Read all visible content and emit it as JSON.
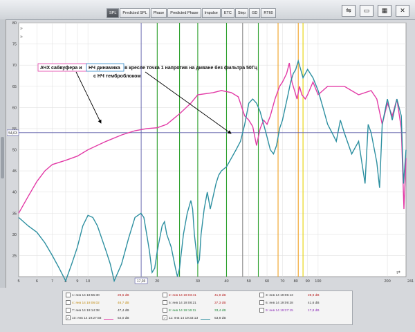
{
  "tabs": [
    "SPL",
    "Predicted SPL",
    "Phase",
    "Predicted Phase",
    "Impulse",
    "ETC",
    "Step",
    "GD",
    "RT60"
  ],
  "active_tab": "SPL",
  "toolbar_icons": [
    "chart-type-icon",
    "display-icon",
    "split-view-icon",
    "settings-icon"
  ],
  "toolbar_glyphs": [
    "⇋",
    "▭",
    "▦",
    "✕"
  ],
  "chart_data": {
    "type": "line",
    "x_scale": "log",
    "xlim": [
      5,
      241
    ],
    "ylim": [
      20,
      80
    ],
    "x_ticks": [
      5,
      6,
      7,
      8,
      9,
      10,
      20,
      30,
      40,
      50,
      60,
      70,
      80,
      90,
      100,
      200
    ],
    "x_end_label": "241 Hz",
    "cursor_x_label": "17,03",
    "y_ticks": [
      25,
      30,
      35,
      40,
      45,
      50,
      55,
      60,
      65,
      70,
      75,
      80
    ],
    "cursor_y_label": "54,03",
    "cursor_x": 17.03,
    "cursor_y": 54.03,
    "green_markers": [
      20,
      25,
      30,
      40,
      55
    ],
    "gray_markers": [
      47
    ],
    "orange_markers": [
      67,
      82
    ],
    "yellow_markers": [
      86
    ],
    "series": [
      {
        "color": "#e23aa6",
        "points": [
          [
            5,
            35
          ],
          [
            5.5,
            39
          ],
          [
            6,
            42.5
          ],
          [
            6.5,
            45
          ],
          [
            7,
            46.5
          ],
          [
            8,
            47.5
          ],
          [
            9,
            48.5
          ],
          [
            10,
            50
          ],
          [
            12,
            52
          ],
          [
            14,
            53.5
          ],
          [
            16,
            54.5
          ],
          [
            18,
            55
          ],
          [
            20,
            55.2
          ],
          [
            22,
            56
          ],
          [
            25,
            58.5
          ],
          [
            28,
            61
          ],
          [
            30,
            63
          ],
          [
            35,
            63.5
          ],
          [
            38,
            64
          ],
          [
            42,
            63.5
          ],
          [
            45,
            62.5
          ],
          [
            48,
            58
          ],
          [
            50,
            57
          ],
          [
            52,
            55.5
          ],
          [
            54,
            51
          ],
          [
            56,
            55
          ],
          [
            58,
            57
          ],
          [
            60,
            56
          ],
          [
            62,
            58
          ],
          [
            65,
            62
          ],
          [
            68,
            65
          ],
          [
            70,
            66
          ],
          [
            73,
            68
          ],
          [
            75,
            70.5
          ],
          [
            77,
            66
          ],
          [
            79,
            64
          ],
          [
            81,
            62
          ],
          [
            83,
            65
          ],
          [
            85,
            63
          ],
          [
            88,
            62
          ],
          [
            90,
            63
          ],
          [
            95,
            66
          ],
          [
            100,
            63
          ],
          [
            110,
            65
          ],
          [
            130,
            65
          ],
          [
            150,
            63
          ],
          [
            170,
            64
          ],
          [
            180,
            62
          ],
          [
            190,
            56
          ],
          [
            200,
            61
          ],
          [
            210,
            58
          ],
          [
            220,
            62
          ],
          [
            230,
            55
          ],
          [
            236,
            36
          ],
          [
            241,
            48
          ]
        ]
      },
      {
        "color": "#2c8fa0",
        "points": [
          [
            5,
            34
          ],
          [
            5.5,
            32
          ],
          [
            6,
            30.5
          ],
          [
            6.5,
            28
          ],
          [
            7,
            25
          ],
          [
            7.5,
            22
          ],
          [
            8,
            19
          ],
          [
            8.5,
            23
          ],
          [
            9,
            27
          ],
          [
            9.5,
            32
          ],
          [
            10,
            34.5
          ],
          [
            10.5,
            34
          ],
          [
            11,
            32
          ],
          [
            12,
            26
          ],
          [
            12.5,
            23
          ],
          [
            13,
            19
          ],
          [
            14,
            23
          ],
          [
            15,
            29
          ],
          [
            16,
            34
          ],
          [
            17,
            35
          ],
          [
            17.5,
            34
          ],
          [
            18,
            30
          ],
          [
            18.5,
            26
          ],
          [
            19,
            21
          ],
          [
            19.5,
            22
          ],
          [
            20,
            26
          ],
          [
            21,
            32
          ],
          [
            21.5,
            33
          ],
          [
            22,
            30
          ],
          [
            23,
            27
          ],
          [
            24,
            22
          ],
          [
            24.5,
            20
          ],
          [
            25,
            22
          ],
          [
            26,
            30
          ],
          [
            27,
            35
          ],
          [
            28,
            38
          ],
          [
            28.5,
            36
          ],
          [
            29,
            30
          ],
          [
            30,
            23
          ],
          [
            30.5,
            24
          ],
          [
            31,
            30
          ],
          [
            32,
            36
          ],
          [
            33,
            40
          ],
          [
            33.5,
            38
          ],
          [
            34,
            36
          ],
          [
            35,
            39
          ],
          [
            36,
            42
          ],
          [
            37,
            44
          ],
          [
            38,
            45
          ],
          [
            40,
            46
          ],
          [
            42,
            48
          ],
          [
            44,
            50
          ],
          [
            46,
            52
          ],
          [
            48,
            56
          ],
          [
            50,
            61
          ],
          [
            52,
            62
          ],
          [
            54,
            61
          ],
          [
            56,
            59
          ],
          [
            58,
            56
          ],
          [
            60,
            53
          ],
          [
            62,
            50
          ],
          [
            64,
            49
          ],
          [
            66,
            51
          ],
          [
            68,
            55
          ],
          [
            70,
            57
          ],
          [
            72,
            60
          ],
          [
            74,
            63
          ],
          [
            76,
            66
          ],
          [
            78,
            68
          ],
          [
            80,
            69
          ],
          [
            82,
            71
          ],
          [
            84,
            69
          ],
          [
            86,
            67
          ],
          [
            88,
            68
          ],
          [
            90,
            69
          ],
          [
            95,
            67
          ],
          [
            100,
            64
          ],
          [
            105,
            60
          ],
          [
            110,
            56
          ],
          [
            115,
            54
          ],
          [
            120,
            52
          ],
          [
            125,
            57
          ],
          [
            130,
            54
          ],
          [
            140,
            49
          ],
          [
            150,
            52
          ],
          [
            160,
            42
          ],
          [
            165,
            56
          ],
          [
            170,
            54
          ],
          [
            180,
            47
          ],
          [
            185,
            41
          ],
          [
            190,
            56
          ],
          [
            200,
            62
          ],
          [
            210,
            57
          ],
          [
            220,
            62
          ],
          [
            230,
            58
          ],
          [
            235,
            42
          ],
          [
            241,
            50
          ]
        ]
      }
    ],
    "annotations": [
      {
        "text": "АЧХ сабвуфера и",
        "box_color": "#e23aa6"
      },
      {
        "text": "НЧ динамика",
        "box_color": "#2a86c8"
      },
      {
        "text": "в кресле  точка 1   напротив на диване  без фильтра 50Гц"
      },
      {
        "text": "с НЧ темброблоком"
      }
    ]
  },
  "legend_rows": [
    [
      {
        "checked": false,
        "name": "1: янв 14 18:55:30",
        "value": "29,6 dB",
        "name_color": "#333",
        "value_color": "#b82020"
      },
      {
        "checked": false,
        "name": "2: янв 14 19:03:41",
        "value": "41,9 dB",
        "name_color": "#b82020",
        "value_color": "#b82020"
      },
      {
        "checked": false,
        "name": "3: янв 14 19:05:13",
        "value": "28,9 dB",
        "name_color": "#333",
        "value_color": "#b82020"
      }
    ],
    [
      {
        "checked": false,
        "name": "4: янв 14 19:06:02",
        "value": "46,7 dB",
        "name_color": "#c08a10",
        "value_color": "#c08a10"
      },
      {
        "checked": false,
        "name": "5: янв 14 19:08:21",
        "value": "37,3 dB",
        "name_color": "#333",
        "value_color": "#b82020"
      },
      {
        "checked": false,
        "name": "6: янв 14 19:09:28",
        "value": "41,6 dB",
        "name_color": "#333",
        "value_color": "#333"
      }
    ],
    [
      {
        "checked": false,
        "name": "7: янв 14 19:14:38",
        "value": "47,4 dB",
        "name_color": "#333",
        "value_color": "#333"
      },
      {
        "checked": false,
        "name": "8: янв 14 19:16:11",
        "value": "33,4 dB",
        "name_color": "#1e8a3a",
        "value_color": "#1e8a3a"
      },
      {
        "checked": false,
        "name": "9: янв 14 19:27:15",
        "value": "17,8 dB",
        "name_color": "#8a2ab8",
        "value_color": "#8a2ab8"
      }
    ],
    [
      {
        "checked": true,
        "name": "10: янв 14 19:27:58",
        "value": "54,0 dB",
        "name_color": "#333",
        "value_color": "#333",
        "swatch": "#e23aa6"
      },
      {
        "checked": true,
        "name": "11: янв 14 19:33:13",
        "value": "53,8 dB",
        "name_color": "#333",
        "value_color": "#333",
        "swatch": "#2c8fa0"
      }
    ]
  ]
}
